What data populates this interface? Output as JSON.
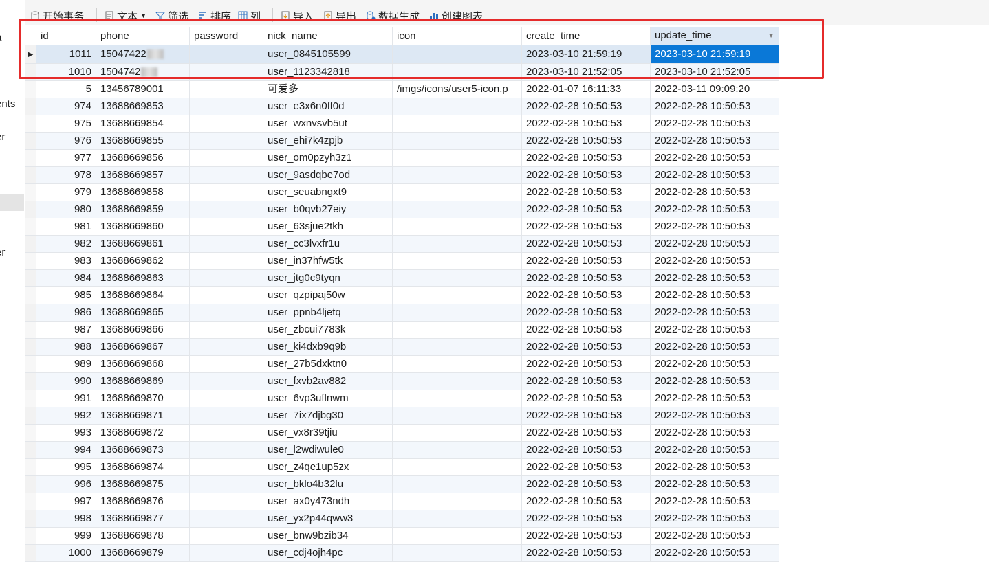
{
  "sidebar": {
    "frags": [
      "a",
      "ents",
      "er",
      "er"
    ]
  },
  "toolbar": {
    "items": [
      {
        "label": "开始事务",
        "icon": "transaction-icon"
      },
      {
        "label": "文本",
        "icon": "text-icon"
      },
      {
        "label": "筛选",
        "icon": "filter-icon"
      },
      {
        "label": "排序",
        "icon": "sort-icon"
      },
      {
        "label": "列",
        "icon": "columns-icon"
      },
      {
        "label": "导入",
        "icon": "import-icon"
      },
      {
        "label": "导出",
        "icon": "export-icon"
      },
      {
        "label": "数据生成",
        "icon": "data-generate-icon"
      },
      {
        "label": "创建图表",
        "icon": "chart-icon"
      }
    ]
  },
  "grid": {
    "columns": [
      "id",
      "phone",
      "password",
      "nick_name",
      "icon",
      "create_time",
      "update_time"
    ],
    "sorted_column": "update_time",
    "selected_cell_value": "2023-03-10 21:59:19",
    "rows": [
      {
        "id": "1011",
        "phone": "15047422",
        "password": "",
        "nick_name": "user_0845105599",
        "icon": "",
        "create_time": "2023-03-10 21:59:19",
        "update_time": "2023-03-10 21:59:19",
        "masked": true
      },
      {
        "id": "1010",
        "phone": "1504742",
        "password": "",
        "nick_name": "user_1123342818",
        "icon": "",
        "create_time": "2023-03-10 21:52:05",
        "update_time": "2023-03-10 21:52:05",
        "masked": true
      },
      {
        "id": "5",
        "phone": "13456789001",
        "password": "",
        "nick_name": "可爱多",
        "icon": "/imgs/icons/user5-icon.p",
        "create_time": "2022-01-07 16:11:33",
        "update_time": "2022-03-11 09:09:20"
      },
      {
        "id": "974",
        "phone": "13688669853",
        "password": "",
        "nick_name": "user_e3x6n0ff0d",
        "icon": "",
        "create_time": "2022-02-28 10:50:53",
        "update_time": "2022-02-28 10:50:53"
      },
      {
        "id": "975",
        "phone": "13688669854",
        "password": "",
        "nick_name": "user_wxnvsvb5ut",
        "icon": "",
        "create_time": "2022-02-28 10:50:53",
        "update_time": "2022-02-28 10:50:53"
      },
      {
        "id": "976",
        "phone": "13688669855",
        "password": "",
        "nick_name": "user_ehi7k4zpjb",
        "icon": "",
        "create_time": "2022-02-28 10:50:53",
        "update_time": "2022-02-28 10:50:53"
      },
      {
        "id": "977",
        "phone": "13688669856",
        "password": "",
        "nick_name": "user_om0pzyh3z1",
        "icon": "",
        "create_time": "2022-02-28 10:50:53",
        "update_time": "2022-02-28 10:50:53"
      },
      {
        "id": "978",
        "phone": "13688669857",
        "password": "",
        "nick_name": "user_9asdqbe7od",
        "icon": "",
        "create_time": "2022-02-28 10:50:53",
        "update_time": "2022-02-28 10:50:53"
      },
      {
        "id": "979",
        "phone": "13688669858",
        "password": "",
        "nick_name": "user_seuabngxt9",
        "icon": "",
        "create_time": "2022-02-28 10:50:53",
        "update_time": "2022-02-28 10:50:53"
      },
      {
        "id": "980",
        "phone": "13688669859",
        "password": "",
        "nick_name": "user_b0qvb27eiy",
        "icon": "",
        "create_time": "2022-02-28 10:50:53",
        "update_time": "2022-02-28 10:50:53"
      },
      {
        "id": "981",
        "phone": "13688669860",
        "password": "",
        "nick_name": "user_63sjue2tkh",
        "icon": "",
        "create_time": "2022-02-28 10:50:53",
        "update_time": "2022-02-28 10:50:53"
      },
      {
        "id": "982",
        "phone": "13688669861",
        "password": "",
        "nick_name": "user_cc3lvxfr1u",
        "icon": "",
        "create_time": "2022-02-28 10:50:53",
        "update_time": "2022-02-28 10:50:53"
      },
      {
        "id": "983",
        "phone": "13688669862",
        "password": "",
        "nick_name": "user_in37hfw5tk",
        "icon": "",
        "create_time": "2022-02-28 10:50:53",
        "update_time": "2022-02-28 10:50:53"
      },
      {
        "id": "984",
        "phone": "13688669863",
        "password": "",
        "nick_name": "user_jtg0c9tyqn",
        "icon": "",
        "create_time": "2022-02-28 10:50:53",
        "update_time": "2022-02-28 10:50:53"
      },
      {
        "id": "985",
        "phone": "13688669864",
        "password": "",
        "nick_name": "user_qzpipaj50w",
        "icon": "",
        "create_time": "2022-02-28 10:50:53",
        "update_time": "2022-02-28 10:50:53"
      },
      {
        "id": "986",
        "phone": "13688669865",
        "password": "",
        "nick_name": "user_ppnb4ljetq",
        "icon": "",
        "create_time": "2022-02-28 10:50:53",
        "update_time": "2022-02-28 10:50:53"
      },
      {
        "id": "987",
        "phone": "13688669866",
        "password": "",
        "nick_name": "user_zbcui7783k",
        "icon": "",
        "create_time": "2022-02-28 10:50:53",
        "update_time": "2022-02-28 10:50:53"
      },
      {
        "id": "988",
        "phone": "13688669867",
        "password": "",
        "nick_name": "user_ki4dxb9q9b",
        "icon": "",
        "create_time": "2022-02-28 10:50:53",
        "update_time": "2022-02-28 10:50:53"
      },
      {
        "id": "989",
        "phone": "13688669868",
        "password": "",
        "nick_name": "user_27b5dxktn0",
        "icon": "",
        "create_time": "2022-02-28 10:50:53",
        "update_time": "2022-02-28 10:50:53"
      },
      {
        "id": "990",
        "phone": "13688669869",
        "password": "",
        "nick_name": "user_fxvb2av882",
        "icon": "",
        "create_time": "2022-02-28 10:50:53",
        "update_time": "2022-02-28 10:50:53"
      },
      {
        "id": "991",
        "phone": "13688669870",
        "password": "",
        "nick_name": "user_6vp3uflnwm",
        "icon": "",
        "create_time": "2022-02-28 10:50:53",
        "update_time": "2022-02-28 10:50:53"
      },
      {
        "id": "992",
        "phone": "13688669871",
        "password": "",
        "nick_name": "user_7ix7djbg30",
        "icon": "",
        "create_time": "2022-02-28 10:50:53",
        "update_time": "2022-02-28 10:50:53"
      },
      {
        "id": "993",
        "phone": "13688669872",
        "password": "",
        "nick_name": "user_vx8r39tjiu",
        "icon": "",
        "create_time": "2022-02-28 10:50:53",
        "update_time": "2022-02-28 10:50:53"
      },
      {
        "id": "994",
        "phone": "13688669873",
        "password": "",
        "nick_name": "user_l2wdiwule0",
        "icon": "",
        "create_time": "2022-02-28 10:50:53",
        "update_time": "2022-02-28 10:50:53"
      },
      {
        "id": "995",
        "phone": "13688669874",
        "password": "",
        "nick_name": "user_z4qe1up5zx",
        "icon": "",
        "create_time": "2022-02-28 10:50:53",
        "update_time": "2022-02-28 10:50:53"
      },
      {
        "id": "996",
        "phone": "13688669875",
        "password": "",
        "nick_name": "user_bklo4b32lu",
        "icon": "",
        "create_time": "2022-02-28 10:50:53",
        "update_time": "2022-02-28 10:50:53"
      },
      {
        "id": "997",
        "phone": "13688669876",
        "password": "",
        "nick_name": "user_ax0y473ndh",
        "icon": "",
        "create_time": "2022-02-28 10:50:53",
        "update_time": "2022-02-28 10:50:53"
      },
      {
        "id": "998",
        "phone": "13688669877",
        "password": "",
        "nick_name": "user_yx2p44qww3",
        "icon": "",
        "create_time": "2022-02-28 10:50:53",
        "update_time": "2022-02-28 10:50:53"
      },
      {
        "id": "999",
        "phone": "13688669878",
        "password": "",
        "nick_name": "user_bnw9bzib34",
        "icon": "",
        "create_time": "2022-02-28 10:50:53",
        "update_time": "2022-02-28 10:50:53"
      },
      {
        "id": "1000",
        "phone": "13688669879",
        "password": "",
        "nick_name": "user_cdj4ojh4pc",
        "icon": "",
        "create_time": "2022-02-28 10:50:53",
        "update_time": "2022-02-28 10:50:53"
      }
    ]
  },
  "colors": {
    "highlight_box": "#e52b2b",
    "selected_cell": "#0a78d7",
    "header_sorted": "#dce8f5"
  }
}
